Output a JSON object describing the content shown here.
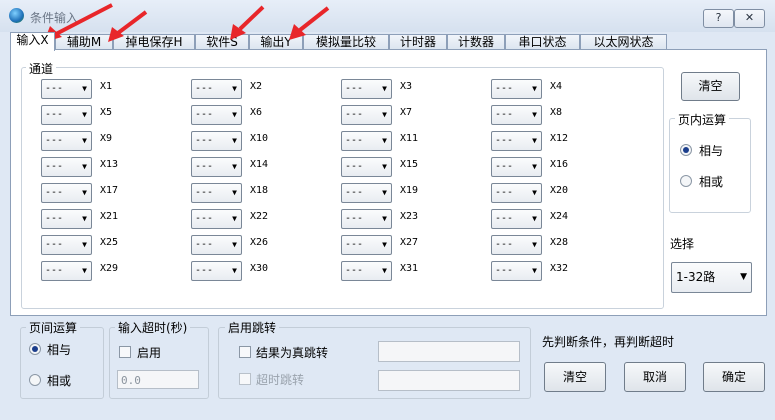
{
  "window": {
    "title": "条件输入",
    "help": "?",
    "close": "✕"
  },
  "tabs": [
    {
      "label": "输入X",
      "active": true
    },
    {
      "label": "辅助M",
      "active": false
    },
    {
      "label": "掉电保存H",
      "active": false
    },
    {
      "label": "软件S",
      "active": false
    },
    {
      "label": "输出Y",
      "active": false
    },
    {
      "label": "模拟量比较",
      "active": false
    },
    {
      "label": "计时器",
      "active": false
    },
    {
      "label": "计数器",
      "active": false
    },
    {
      "label": "串口状态",
      "active": false
    },
    {
      "label": "以太网状态",
      "active": false
    }
  ],
  "channel_group": {
    "title": "通道",
    "combo_value": "---",
    "labels": [
      "X1",
      "X2",
      "X3",
      "X4",
      "X5",
      "X6",
      "X7",
      "X8",
      "X9",
      "X10",
      "X11",
      "X12",
      "X13",
      "X14",
      "X15",
      "X16",
      "X17",
      "X18",
      "X19",
      "X20",
      "X21",
      "X22",
      "X23",
      "X24",
      "X25",
      "X26",
      "X27",
      "X28",
      "X29",
      "X30",
      "X31",
      "X32"
    ]
  },
  "clear_top": "清空",
  "inpage": {
    "title": "页内运算",
    "and": "相与",
    "or": "相或",
    "selected": "and"
  },
  "select": {
    "label": "选择",
    "value": "1-32路"
  },
  "page_op": {
    "title": "页间运算",
    "and": "相与",
    "or": "相或",
    "selected": "and"
  },
  "timeout": {
    "title": "输入超时(秒)",
    "enable": "启用",
    "value": "0.0"
  },
  "jump": {
    "title": "启用跳转",
    "true_jump": "结果为真跳转",
    "timeout_jump": "超时跳转"
  },
  "note": "先判断条件，再判断超时",
  "buttons": {
    "clear": "清空",
    "cancel": "取消",
    "ok": "确定"
  },
  "colors": {
    "accent_red": "#e8262a",
    "radio_dot": "#1b3e8c",
    "window_bg": "#dfe8f4"
  }
}
